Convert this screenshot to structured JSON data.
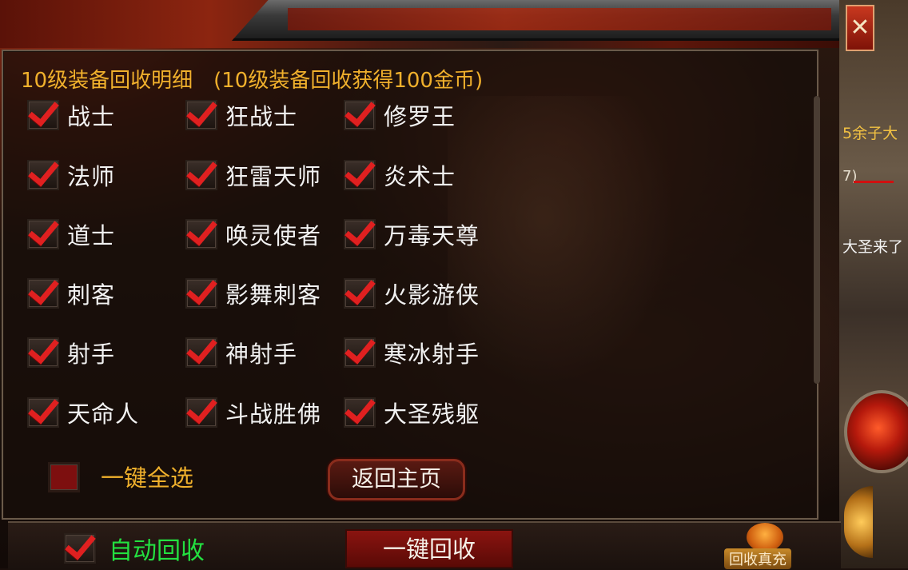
{
  "title": "10级装备回收明细",
  "title_note": "(10级装备回收获得100金币)",
  "close_label": "✕",
  "classes": [
    {
      "label": "战士",
      "checked": true
    },
    {
      "label": "狂战士",
      "checked": true
    },
    {
      "label": "修罗王",
      "checked": true
    },
    {
      "label": "法师",
      "checked": true
    },
    {
      "label": "狂雷天师",
      "checked": true
    },
    {
      "label": "炎术士",
      "checked": true
    },
    {
      "label": "道士",
      "checked": true
    },
    {
      "label": "唤灵使者",
      "checked": true
    },
    {
      "label": "万毒天尊",
      "checked": true
    },
    {
      "label": "刺客",
      "checked": true
    },
    {
      "label": "影舞刺客",
      "checked": true
    },
    {
      "label": "火影游侠",
      "checked": true
    },
    {
      "label": "射手",
      "checked": true
    },
    {
      "label": "神射手",
      "checked": true
    },
    {
      "label": "寒冰射手",
      "checked": true
    },
    {
      "label": "天命人",
      "checked": true
    },
    {
      "label": "斗战胜佛",
      "checked": true
    },
    {
      "label": "大圣残躯",
      "checked": true
    }
  ],
  "select_all": {
    "label": "一键全选",
    "checked": false
  },
  "home_button": "返回主页",
  "auto_recycle": {
    "label": "自动回收",
    "checked": true
  },
  "recycle_button": "一键回收",
  "recharge_label": "回收真充",
  "side_texts": {
    "line1": "5余子大",
    "line2": "7)",
    "line3": "大圣来了"
  },
  "colors": {
    "accent_gold": "#f0b02c",
    "check_red": "#e02020",
    "auto_green": "#23e040"
  }
}
